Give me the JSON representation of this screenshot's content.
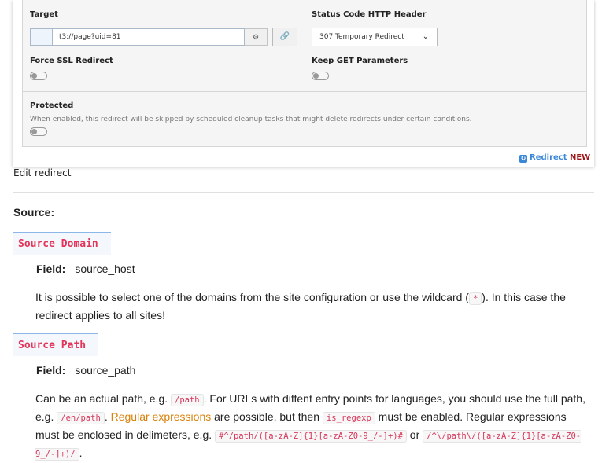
{
  "form": {
    "target_label": "Target",
    "target_value": "t3://page?uid=81",
    "status_label": "Status Code HTTP Header",
    "status_value": "307 Temporary Redirect",
    "force_ssl_label": "Force SSL Redirect",
    "keep_get_label": "Keep GET Parameters",
    "protected_label": "Protected",
    "protected_help": "When enabled, this redirect will be skipped by scheduled cleanup tasks that might delete redirects under certain conditions.",
    "badge_redirect": "Redirect",
    "badge_new": "NEW"
  },
  "caption": "Edit redirect",
  "doc": {
    "source_heading": "Source:",
    "domain_heading": "Source Domain",
    "field_label": "Field:",
    "domain_field": "source_host",
    "domain_text_1": "It is possible to select one of the domains from the site configuration or use the wildcard (",
    "wildcard": "*",
    "domain_text_2": "). In this case the redirect applies to all sites!",
    "path_heading": "Source Path",
    "path_field": "source_path",
    "path_text_1": "Can be an actual path, e.g. ",
    "path_code_1": "/path",
    "path_text_2": ". For URLs with diffent entry points for languages, you should use the full path, e.g. ",
    "path_code_2": "/en/path",
    "path_text_3": ". ",
    "regex_link": "Regular expressions",
    "path_text_4": " are possible, but then ",
    "path_code_3": "is_regexp",
    "path_text_5": " must be enabled. Regular expressions must be enclosed in delimeters, e.g. ",
    "path_code_4": "#^/path/([a-zA-Z]{1}[a-zA-Z0-9_/-]+)#",
    "path_text_6": " or ",
    "path_code_5": "/^\\/path\\/([a-zA-Z]{1}[a-zA-Z0-9_/-]+)/",
    "path_text_7": "."
  }
}
